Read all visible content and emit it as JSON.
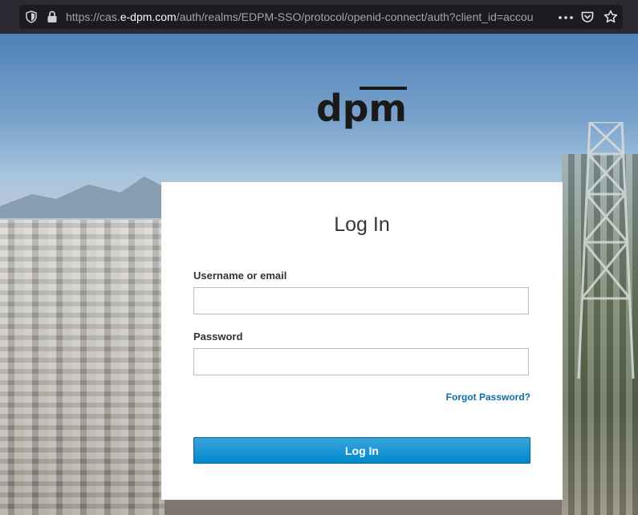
{
  "browser": {
    "url_prefix": "https://cas.",
    "url_host": "e-dpm.com",
    "url_rest": "/auth/realms/EDPM-SSO/protocol/openid-connect/auth?client_id=accou",
    "icons": [
      "shield-icon",
      "lock-icon",
      "more-icon",
      "pocket-icon",
      "star-icon"
    ]
  },
  "logo": {
    "text": "dpm"
  },
  "login": {
    "title": "Log In",
    "username_label": "Username or email",
    "username_value": "",
    "password_label": "Password",
    "password_value": "",
    "forgot_link": "Forgot Password?",
    "submit_label": "Log In"
  },
  "colors": {
    "button_top": "#39a5dc",
    "button_bottom": "#0088ce",
    "link": "#0b6ea8"
  }
}
